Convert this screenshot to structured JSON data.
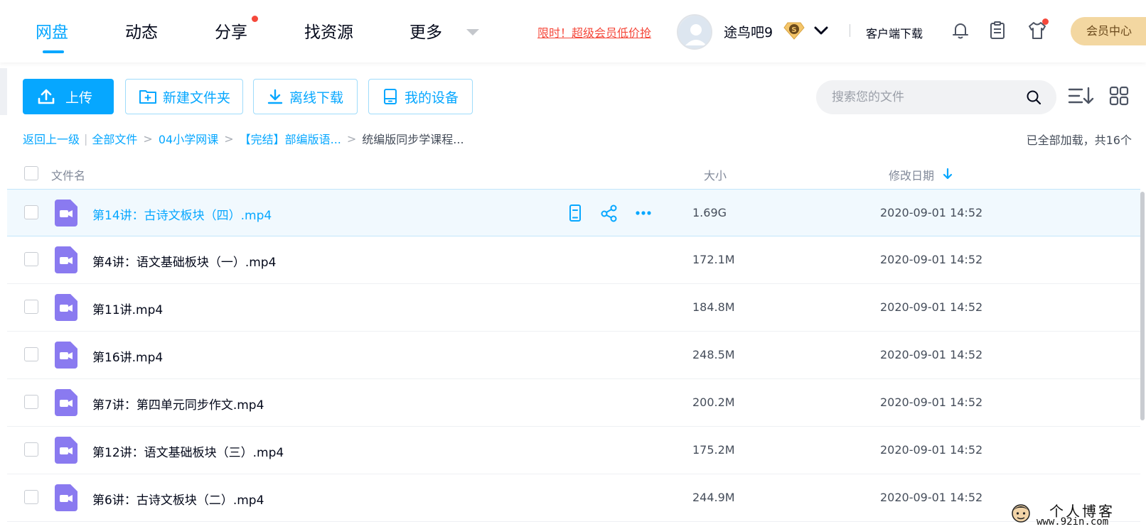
{
  "nav": {
    "tabs": [
      {
        "label": "网盘",
        "active": true
      },
      {
        "label": "动态",
        "active": false
      },
      {
        "label": "分享",
        "active": false,
        "has_dot": true
      },
      {
        "label": "找资源",
        "active": false
      },
      {
        "label": "更多",
        "active": false
      }
    ],
    "promo_text": "限时！超级会员低价抢",
    "username": "途鸟吧9",
    "svip_badge": "S",
    "client_download": "客户端下载",
    "vip_center": "会员中心"
  },
  "toolbar": {
    "upload_label": "上传",
    "new_folder_label": "新建文件夹",
    "offline_download_label": "离线下载",
    "my_devices_label": "我的设备",
    "search_placeholder": "搜索您的文件"
  },
  "breadcrumb": {
    "back": "返回上一级",
    "items": [
      "全部文件",
      "04小学网课",
      "【完结】部编版语..."
    ],
    "current": "统编版同步学课程...",
    "status": "已全部加载，共16个"
  },
  "table": {
    "headers": {
      "name": "文件名",
      "size": "大小",
      "date": "修改日期"
    },
    "sort_direction": "desc",
    "rows": [
      {
        "name": "第14讲：古诗文板块（四）.mp4",
        "size": "1.69G",
        "date": "2020-09-01 14:52",
        "selected": true
      },
      {
        "name": "第4讲：语文基础板块（一）.mp4",
        "size": "172.1M",
        "date": "2020-09-01 14:52",
        "selected": false
      },
      {
        "name": "第11讲.mp4",
        "size": "184.8M",
        "date": "2020-09-01 14:52",
        "selected": false
      },
      {
        "name": "第16讲.mp4",
        "size": "248.5M",
        "date": "2020-09-01 14:52",
        "selected": false
      },
      {
        "name": "第7讲：第四单元同步作文.mp4",
        "size": "200.2M",
        "date": "2020-09-01 14:52",
        "selected": false
      },
      {
        "name": "第12讲：语文基础板块（三）.mp4",
        "size": "175.2M",
        "date": "2020-09-01 14:52",
        "selected": false
      },
      {
        "name": "第6讲：古诗文板块（二）.mp4",
        "size": "244.9M",
        "date": "2020-09-01 14:52",
        "selected": false
      }
    ]
  },
  "watermark": {
    "title": "个人博客",
    "url": "www.92in.com"
  },
  "colors": {
    "accent": "#06a7ff",
    "red": "#f5483b",
    "video_icon": "#8a7af0",
    "vip_gold": "#f3d7a1"
  },
  "icons": [
    "upload-icon",
    "new-folder-icon",
    "download-icon",
    "device-icon",
    "search-icon",
    "sort-icon",
    "grid-view-icon",
    "bell-icon",
    "clipboard-icon",
    "shirt-icon",
    "video-file-icon",
    "phone-icon",
    "share-icon",
    "more-icon"
  ]
}
